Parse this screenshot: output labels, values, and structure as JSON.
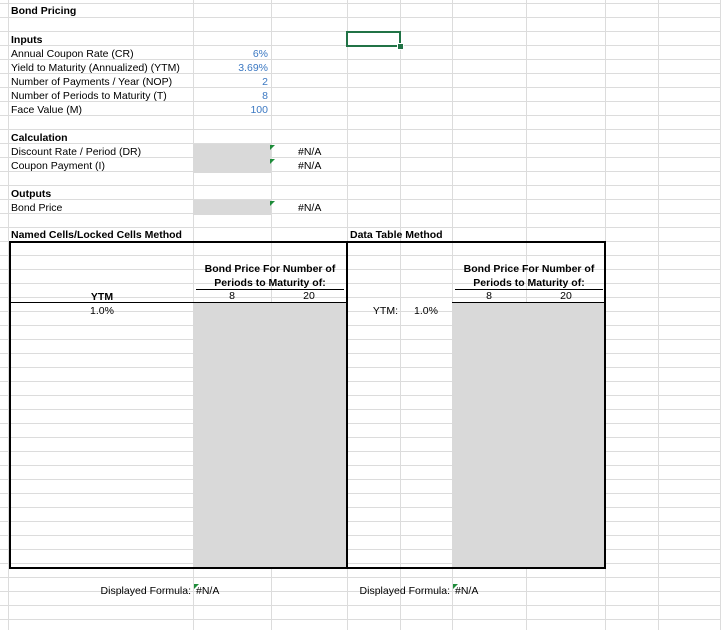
{
  "title": "Bond Pricing",
  "inputs": {
    "header": "Inputs",
    "rows": [
      {
        "label": "Annual Coupon Rate (CR)",
        "value": "6%"
      },
      {
        "label": "Yield to Maturity (Annualized) (YTM)",
        "value": "3.69%"
      },
      {
        "label": "Number of Payments / Year (NOP)",
        "value": "2"
      },
      {
        "label": "Number of Periods to Maturity (T)",
        "value": "8"
      },
      {
        "label": "Face Value (M)",
        "value": "100"
      }
    ]
  },
  "calculation": {
    "header": "Calculation",
    "rows": [
      {
        "label": "Discount Rate / Period (DR)",
        "value": "#N/A"
      },
      {
        "label": "Coupon Payment (I)",
        "value": "#N/A"
      }
    ]
  },
  "outputs": {
    "header": "Outputs",
    "rows": [
      {
        "label": "Bond Price",
        "value": "#N/A"
      }
    ]
  },
  "named_method": {
    "title": "Named Cells/Locked Cells Method",
    "header_line1": "Bond Price For Number of",
    "header_line2": "Periods to Maturity of:",
    "col_a": "8",
    "col_b": "20",
    "ytm_label": "YTM",
    "ytm_value": "1.0%",
    "formula_label": "Displayed Formula:",
    "formula_value": "#N/A"
  },
  "data_table_method": {
    "title": "Data Table Method",
    "header_line1": "Bond Price For Number of",
    "header_line2": "Periods to Maturity of:",
    "col_a": "8",
    "col_b": "20",
    "ytm_label": "YTM:",
    "ytm_value": "1.0%",
    "formula_label": "Displayed Formula:",
    "formula_value": "#N/A"
  }
}
